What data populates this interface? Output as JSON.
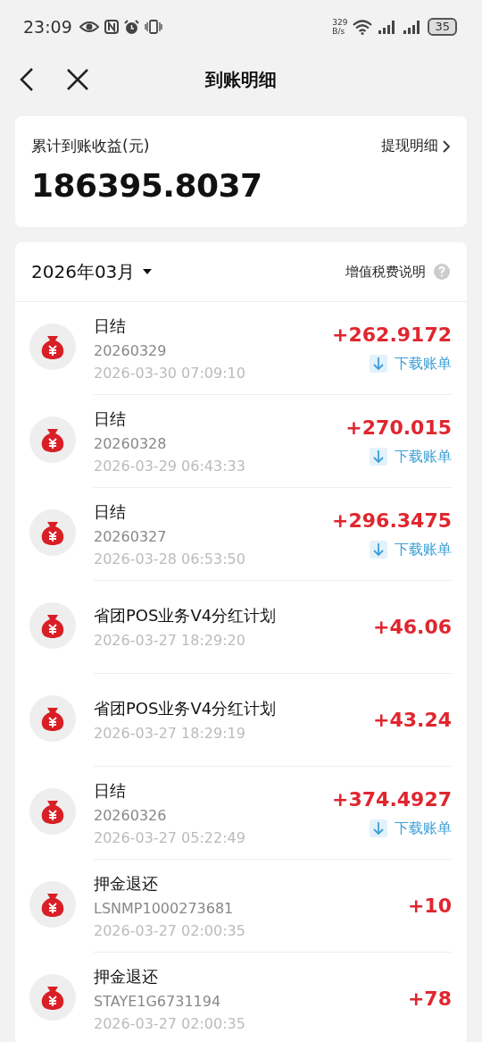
{
  "status_bar": {
    "time": "23:09",
    "speed_value": "329",
    "speed_unit": "B/s",
    "battery": "35"
  },
  "nav": {
    "title": "到账明细"
  },
  "summary": {
    "label": "累计到账收益(元)",
    "link": "提现明细",
    "total": "186395.8037"
  },
  "list": {
    "month": "2026年03月",
    "tax_note": "增值税费说明",
    "rows": [
      {
        "title": "日结",
        "code": "20260329",
        "time": "2026-03-30 07:09:10",
        "amount": "+262.9172",
        "download": "下载账单"
      },
      {
        "title": "日结",
        "code": "20260328",
        "time": "2026-03-29 06:43:33",
        "amount": "+270.015",
        "download": "下载账单"
      },
      {
        "title": "日结",
        "code": "20260327",
        "time": "2026-03-28 06:53:50",
        "amount": "+296.3475",
        "download": "下载账单"
      },
      {
        "title": "省团POS业务V4分红计划",
        "time": "2026-03-27 18:29:20",
        "amount": "+46.06"
      },
      {
        "title": "省团POS业务V4分红计划",
        "time": "2026-03-27 18:29:19",
        "amount": "+43.24"
      },
      {
        "title": "日结",
        "code": "20260326",
        "time": "2026-03-27 05:22:49",
        "amount": "+374.4927",
        "download": "下载账单"
      },
      {
        "title": "押金退还",
        "code": "LSNMP1000273681",
        "time": "2026-03-27 02:00:35",
        "amount": "+10"
      },
      {
        "title": "押金退还",
        "code": "STAYE1G6731194",
        "time": "2026-03-27 02:00:35",
        "amount": "+78"
      }
    ]
  }
}
